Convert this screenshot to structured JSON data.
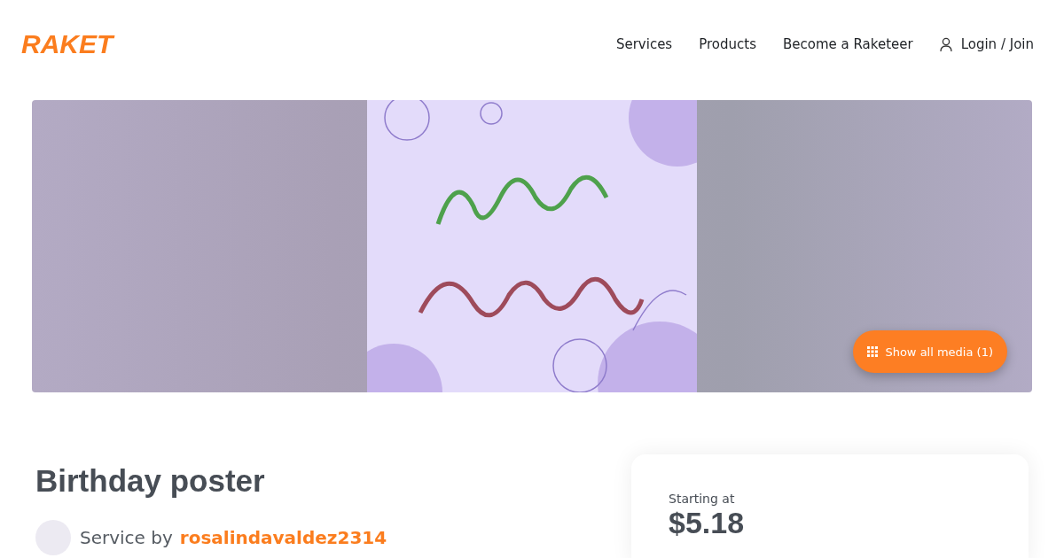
{
  "header": {
    "logo": "RAKET",
    "nav": [
      {
        "label": "Services",
        "kind": "link"
      },
      {
        "label": "Products",
        "kind": "link"
      },
      {
        "label": "Become a Raketeer",
        "kind": "link"
      },
      {
        "label": "Login / Join",
        "kind": "login"
      }
    ]
  },
  "gallery": {
    "button": "Show all media (1)"
  },
  "service": {
    "title": "Birthday poster",
    "by_label": "Service by",
    "seller": "rosalindavaldez2314"
  },
  "price_card": {
    "label": "Starting at",
    "price": "$5.18"
  }
}
